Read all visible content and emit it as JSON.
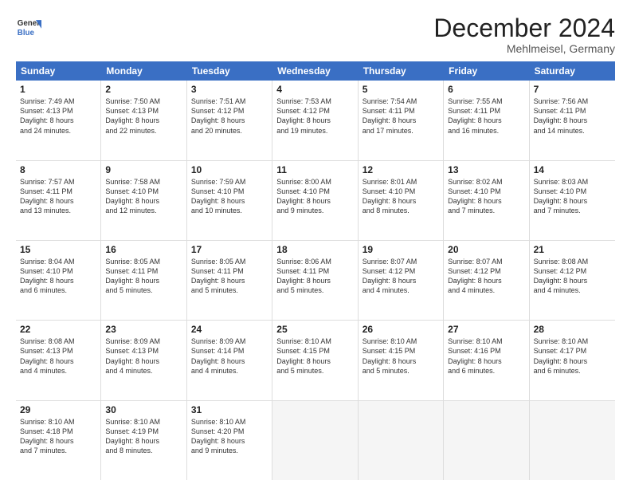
{
  "header": {
    "logo_line1": "General",
    "logo_line2": "Blue",
    "month": "December 2024",
    "location": "Mehlmeisel, Germany"
  },
  "weekdays": [
    "Sunday",
    "Monday",
    "Tuesday",
    "Wednesday",
    "Thursday",
    "Friday",
    "Saturday"
  ],
  "weeks": [
    [
      {
        "day": "1",
        "lines": [
          "Sunrise: 7:49 AM",
          "Sunset: 4:13 PM",
          "Daylight: 8 hours",
          "and 24 minutes."
        ]
      },
      {
        "day": "2",
        "lines": [
          "Sunrise: 7:50 AM",
          "Sunset: 4:13 PM",
          "Daylight: 8 hours",
          "and 22 minutes."
        ]
      },
      {
        "day": "3",
        "lines": [
          "Sunrise: 7:51 AM",
          "Sunset: 4:12 PM",
          "Daylight: 8 hours",
          "and 20 minutes."
        ]
      },
      {
        "day": "4",
        "lines": [
          "Sunrise: 7:53 AM",
          "Sunset: 4:12 PM",
          "Daylight: 8 hours",
          "and 19 minutes."
        ]
      },
      {
        "day": "5",
        "lines": [
          "Sunrise: 7:54 AM",
          "Sunset: 4:11 PM",
          "Daylight: 8 hours",
          "and 17 minutes."
        ]
      },
      {
        "day": "6",
        "lines": [
          "Sunrise: 7:55 AM",
          "Sunset: 4:11 PM",
          "Daylight: 8 hours",
          "and 16 minutes."
        ]
      },
      {
        "day": "7",
        "lines": [
          "Sunrise: 7:56 AM",
          "Sunset: 4:11 PM",
          "Daylight: 8 hours",
          "and 14 minutes."
        ]
      }
    ],
    [
      {
        "day": "8",
        "lines": [
          "Sunrise: 7:57 AM",
          "Sunset: 4:11 PM",
          "Daylight: 8 hours",
          "and 13 minutes."
        ]
      },
      {
        "day": "9",
        "lines": [
          "Sunrise: 7:58 AM",
          "Sunset: 4:10 PM",
          "Daylight: 8 hours",
          "and 12 minutes."
        ]
      },
      {
        "day": "10",
        "lines": [
          "Sunrise: 7:59 AM",
          "Sunset: 4:10 PM",
          "Daylight: 8 hours",
          "and 10 minutes."
        ]
      },
      {
        "day": "11",
        "lines": [
          "Sunrise: 8:00 AM",
          "Sunset: 4:10 PM",
          "Daylight: 8 hours",
          "and 9 minutes."
        ]
      },
      {
        "day": "12",
        "lines": [
          "Sunrise: 8:01 AM",
          "Sunset: 4:10 PM",
          "Daylight: 8 hours",
          "and 8 minutes."
        ]
      },
      {
        "day": "13",
        "lines": [
          "Sunrise: 8:02 AM",
          "Sunset: 4:10 PM",
          "Daylight: 8 hours",
          "and 7 minutes."
        ]
      },
      {
        "day": "14",
        "lines": [
          "Sunrise: 8:03 AM",
          "Sunset: 4:10 PM",
          "Daylight: 8 hours",
          "and 7 minutes."
        ]
      }
    ],
    [
      {
        "day": "15",
        "lines": [
          "Sunrise: 8:04 AM",
          "Sunset: 4:10 PM",
          "Daylight: 8 hours",
          "and 6 minutes."
        ]
      },
      {
        "day": "16",
        "lines": [
          "Sunrise: 8:05 AM",
          "Sunset: 4:11 PM",
          "Daylight: 8 hours",
          "and 5 minutes."
        ]
      },
      {
        "day": "17",
        "lines": [
          "Sunrise: 8:05 AM",
          "Sunset: 4:11 PM",
          "Daylight: 8 hours",
          "and 5 minutes."
        ]
      },
      {
        "day": "18",
        "lines": [
          "Sunrise: 8:06 AM",
          "Sunset: 4:11 PM",
          "Daylight: 8 hours",
          "and 5 minutes."
        ]
      },
      {
        "day": "19",
        "lines": [
          "Sunrise: 8:07 AM",
          "Sunset: 4:12 PM",
          "Daylight: 8 hours",
          "and 4 minutes."
        ]
      },
      {
        "day": "20",
        "lines": [
          "Sunrise: 8:07 AM",
          "Sunset: 4:12 PM",
          "Daylight: 8 hours",
          "and 4 minutes."
        ]
      },
      {
        "day": "21",
        "lines": [
          "Sunrise: 8:08 AM",
          "Sunset: 4:12 PM",
          "Daylight: 8 hours",
          "and 4 minutes."
        ]
      }
    ],
    [
      {
        "day": "22",
        "lines": [
          "Sunrise: 8:08 AM",
          "Sunset: 4:13 PM",
          "Daylight: 8 hours",
          "and 4 minutes."
        ]
      },
      {
        "day": "23",
        "lines": [
          "Sunrise: 8:09 AM",
          "Sunset: 4:13 PM",
          "Daylight: 8 hours",
          "and 4 minutes."
        ]
      },
      {
        "day": "24",
        "lines": [
          "Sunrise: 8:09 AM",
          "Sunset: 4:14 PM",
          "Daylight: 8 hours",
          "and 4 minutes."
        ]
      },
      {
        "day": "25",
        "lines": [
          "Sunrise: 8:10 AM",
          "Sunset: 4:15 PM",
          "Daylight: 8 hours",
          "and 5 minutes."
        ]
      },
      {
        "day": "26",
        "lines": [
          "Sunrise: 8:10 AM",
          "Sunset: 4:15 PM",
          "Daylight: 8 hours",
          "and 5 minutes."
        ]
      },
      {
        "day": "27",
        "lines": [
          "Sunrise: 8:10 AM",
          "Sunset: 4:16 PM",
          "Daylight: 8 hours",
          "and 6 minutes."
        ]
      },
      {
        "day": "28",
        "lines": [
          "Sunrise: 8:10 AM",
          "Sunset: 4:17 PM",
          "Daylight: 8 hours",
          "and 6 minutes."
        ]
      }
    ],
    [
      {
        "day": "29",
        "lines": [
          "Sunrise: 8:10 AM",
          "Sunset: 4:18 PM",
          "Daylight: 8 hours",
          "and 7 minutes."
        ]
      },
      {
        "day": "30",
        "lines": [
          "Sunrise: 8:10 AM",
          "Sunset: 4:19 PM",
          "Daylight: 8 hours",
          "and 8 minutes."
        ]
      },
      {
        "day": "31",
        "lines": [
          "Sunrise: 8:10 AM",
          "Sunset: 4:20 PM",
          "Daylight: 8 hours",
          "and 9 minutes."
        ]
      },
      null,
      null,
      null,
      null
    ]
  ]
}
